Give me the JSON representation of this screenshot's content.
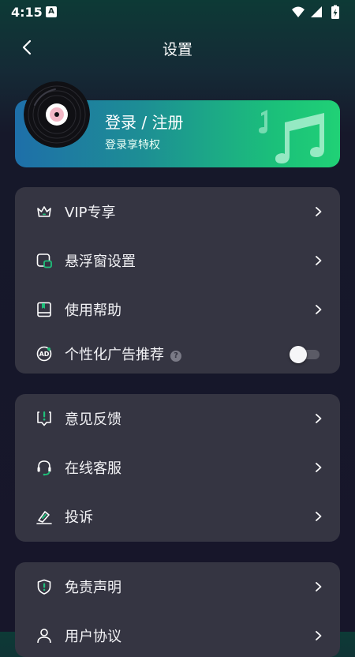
{
  "status_bar": {
    "time": "4:15",
    "notification_glyph": "A"
  },
  "header": {
    "title": "设置"
  },
  "login_card": {
    "title": "登录 / 注册",
    "subtitle": "登录享特权"
  },
  "group1": {
    "items": [
      {
        "label": "VIP专享",
        "icon": "crown-icon"
      },
      {
        "label": "悬浮窗设置",
        "icon": "floating-window-icon"
      },
      {
        "label": "使用帮助",
        "icon": "help-book-icon"
      },
      {
        "label": "个性化广告推荐",
        "icon": "ad-icon",
        "help_badge": "?",
        "toggle_on": false
      }
    ]
  },
  "group2": {
    "items": [
      {
        "label": "意见反馈",
        "icon": "feedback-icon"
      },
      {
        "label": "在线客服",
        "icon": "headset-icon"
      },
      {
        "label": "投诉",
        "icon": "complaint-icon"
      }
    ]
  },
  "group3": {
    "items": [
      {
        "label": "免责声明",
        "icon": "shield-icon"
      },
      {
        "label": "用户协议",
        "icon": "user-agreement-icon"
      }
    ]
  },
  "colors": {
    "accent_green": "#1ec07a",
    "card_bg": "#353542",
    "page_bg": "#17162a"
  }
}
